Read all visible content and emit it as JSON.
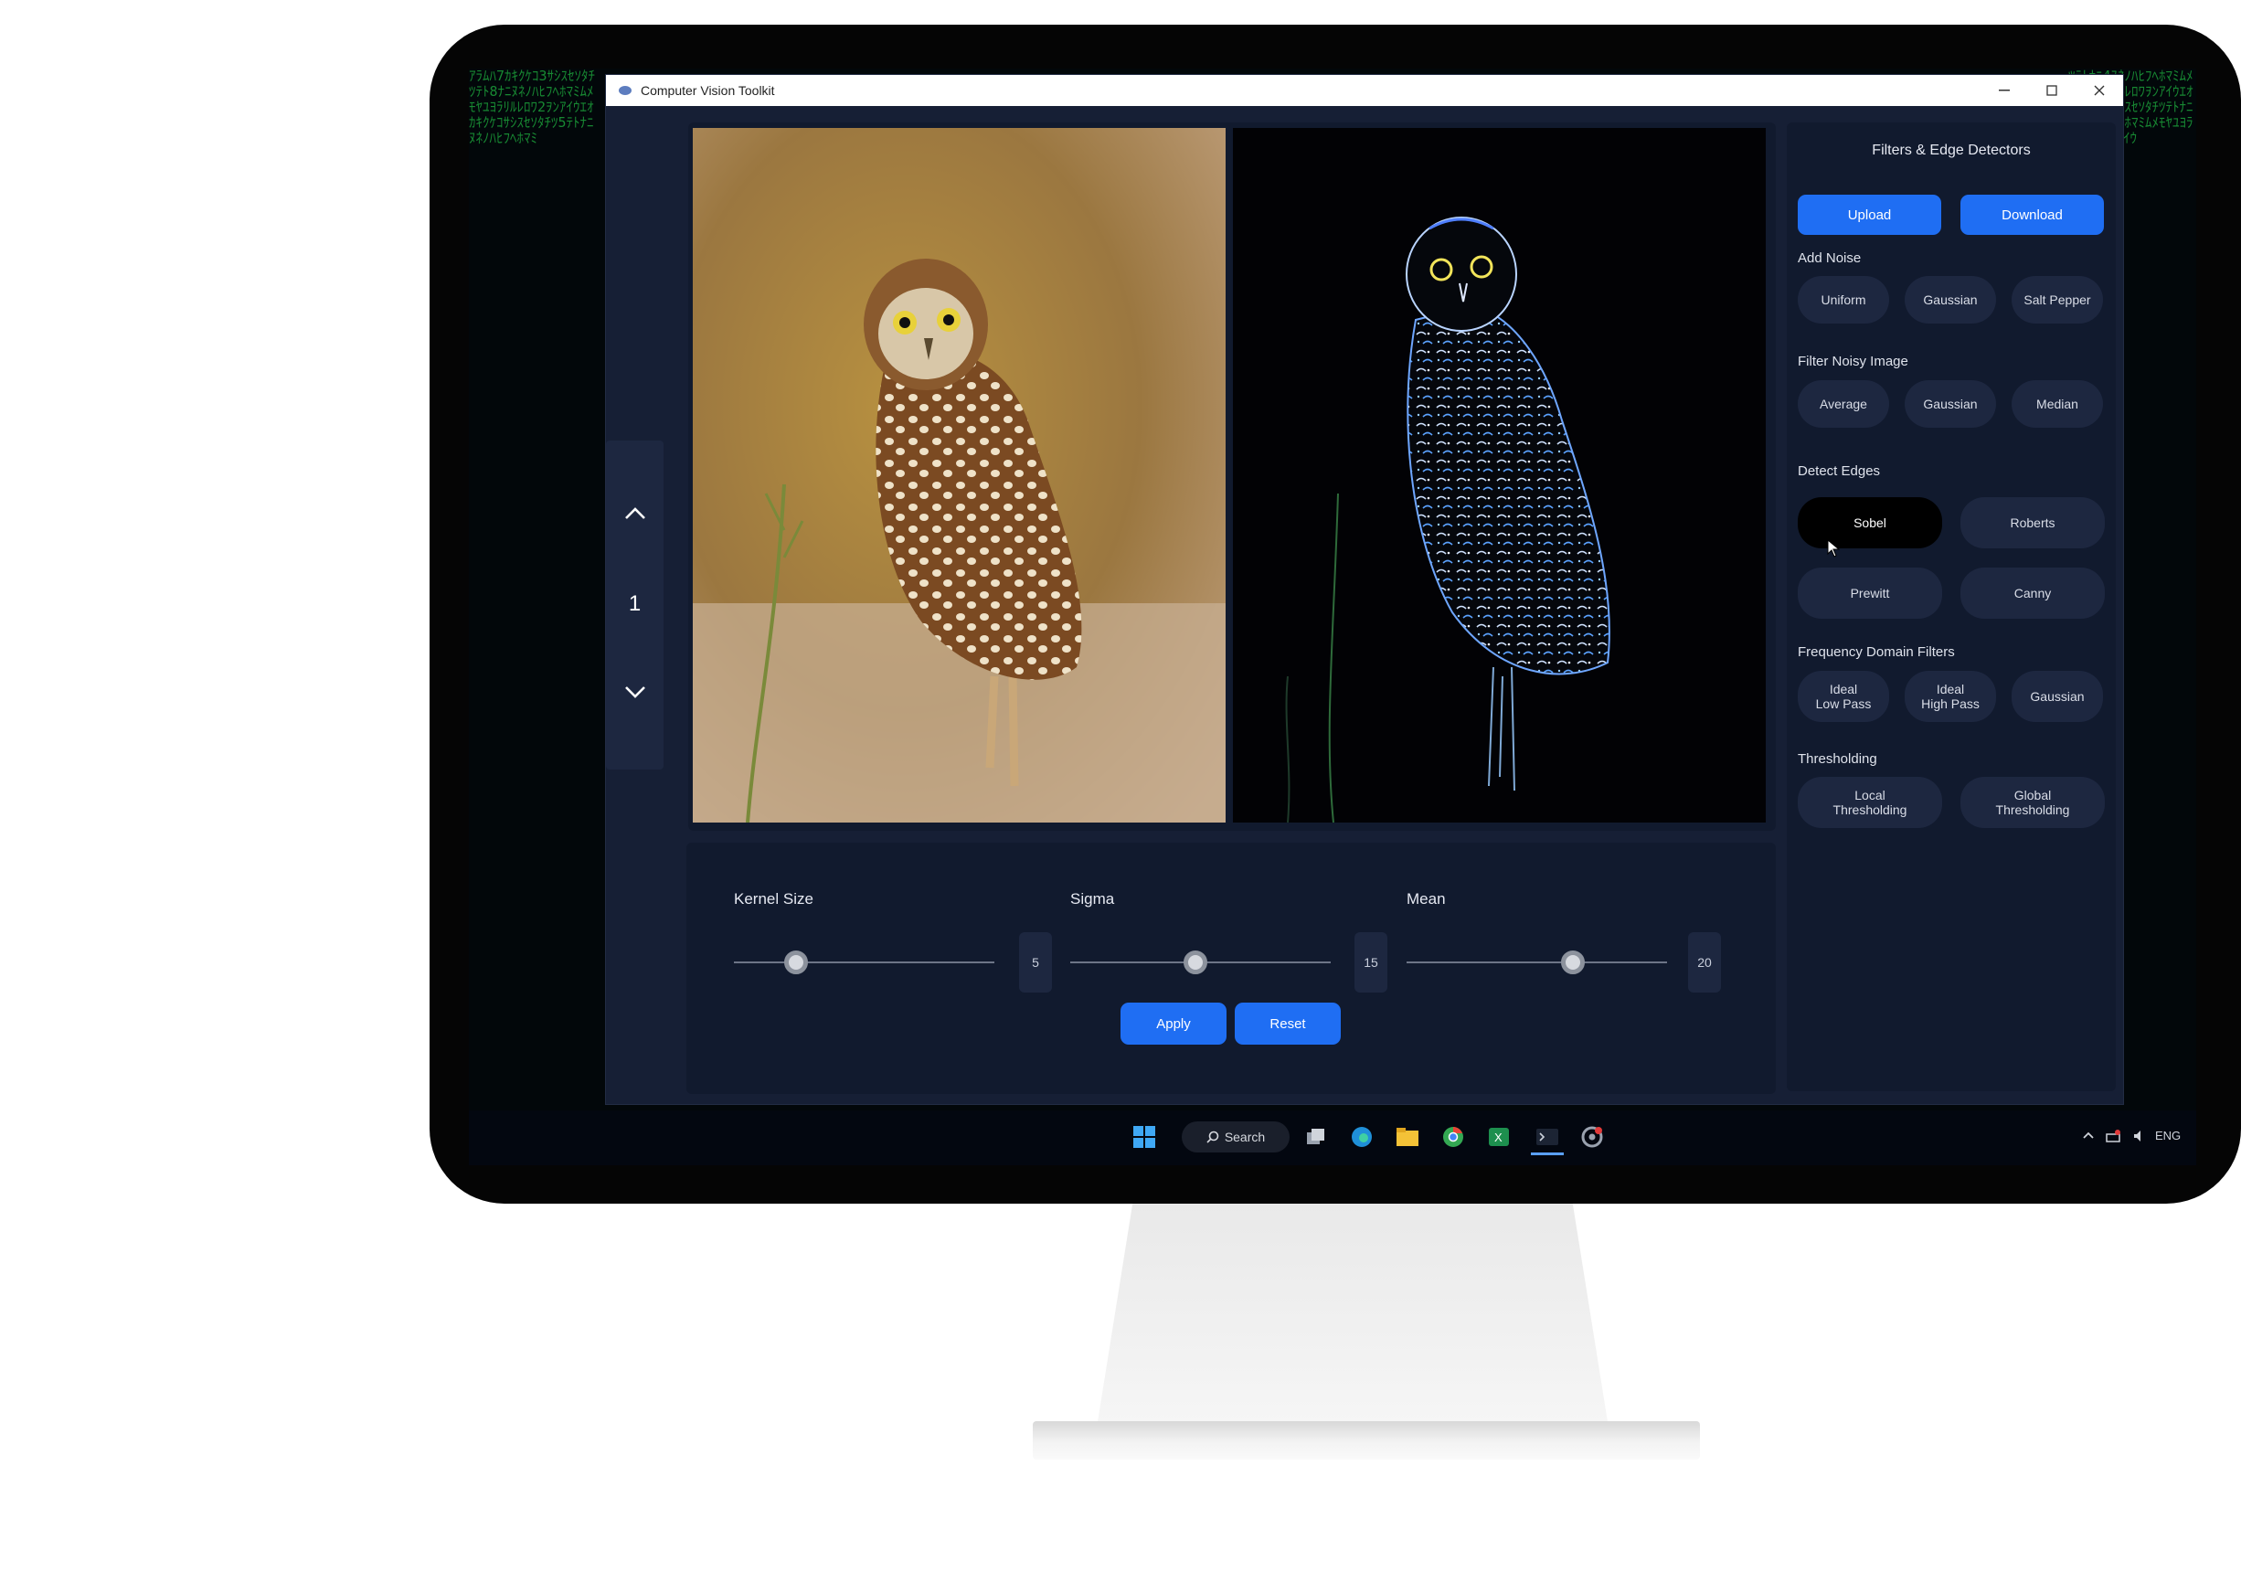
{
  "window": {
    "title": "Computer Vision Toolkit",
    "controls": [
      "minimize",
      "maximize",
      "close"
    ]
  },
  "navigator": {
    "up_icon": "chevron-up-icon",
    "page": "1",
    "down_icon": "chevron-down-icon"
  },
  "images": {
    "original": "owl-color-photo",
    "processed": "owl-edge-detected"
  },
  "controls": {
    "kernel": {
      "label": "Kernel Size",
      "value": "5",
      "level": 0.24
    },
    "sigma": {
      "label": "Sigma",
      "value": "15",
      "level": 0.48
    },
    "mean": {
      "label": "Mean",
      "value": "20",
      "level": 0.64
    },
    "apply_label": "Apply",
    "reset_label": "Reset"
  },
  "panel": {
    "title": "Filters & Edge Detectors",
    "upload_label": "Upload",
    "download_label": "Download",
    "noise": {
      "label": "Add Noise",
      "uniform": "Uniform",
      "gaussian": "Gaussian",
      "salt_pepper": "Salt Pepper"
    },
    "filter": {
      "label": "Filter Noisy Image",
      "average": "Average",
      "gaussian": "Gaussian",
      "median": "Median"
    },
    "edges": {
      "label": "Detect Edges",
      "sobel": "Sobel",
      "roberts": "Roberts",
      "prewitt": "Prewitt",
      "canny": "Canny",
      "selected": "Sobel"
    },
    "frequency": {
      "label": "Frequency Domain Filters",
      "low_1": "Ideal",
      "low_2": "Low Pass",
      "high_1": "Ideal",
      "high_2": "High Pass",
      "gaussian": "Gaussian"
    },
    "threshold": {
      "label": "Thresholding",
      "local_1": "Local",
      "local_2": "Thresholding",
      "global_1": "Global",
      "global_2": "Thresholding"
    }
  },
  "taskbar": {
    "search_label": "Search",
    "language": "ENG",
    "icons": [
      "windows-start-icon",
      "search-icon",
      "task-view-icon",
      "edge-browser-icon",
      "file-explorer-icon",
      "chrome-icon",
      "excel-icon",
      "terminal-icon",
      "settings-icon"
    ]
  },
  "colors": {
    "accent": "#1f6ef3",
    "window_bg": "#161f35",
    "panel_bg": "#111a2e",
    "pill_bg": "#1d2740",
    "matrix_green": "#1fb340"
  }
}
